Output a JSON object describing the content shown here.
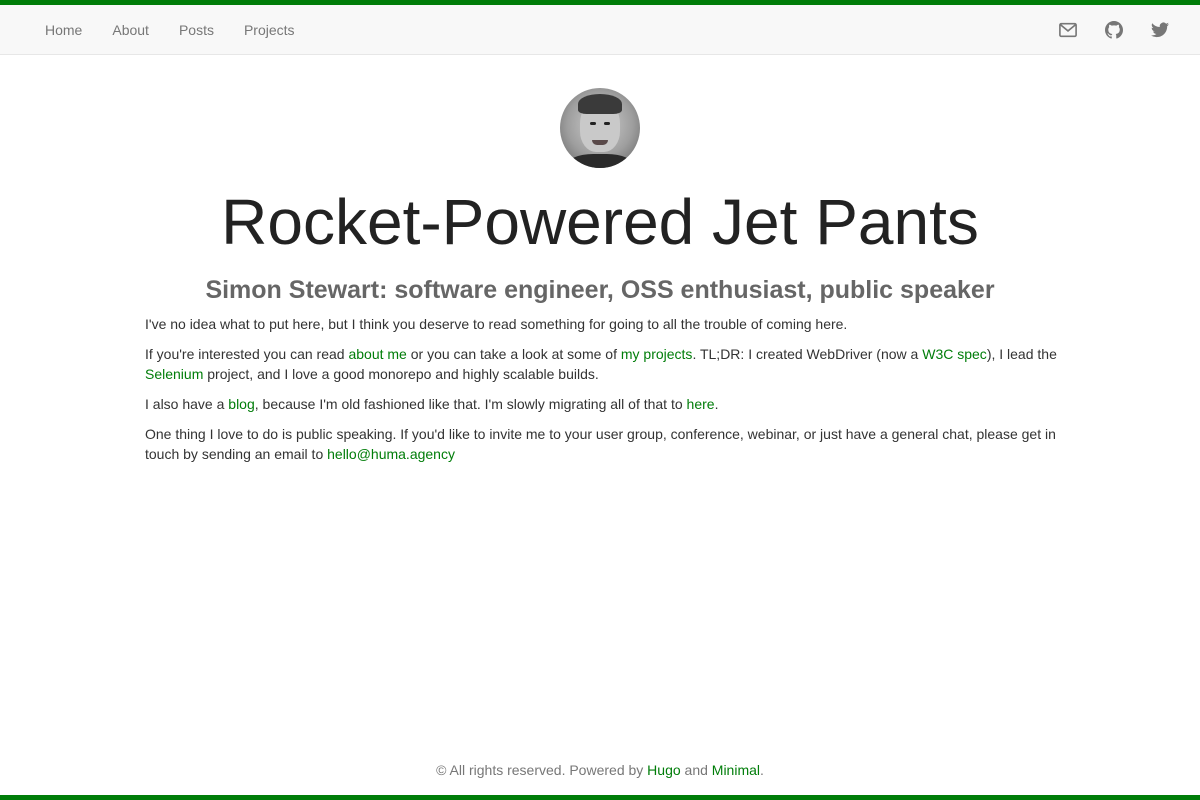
{
  "nav": {
    "links": [
      "Home",
      "About",
      "Posts",
      "Projects"
    ],
    "icons": [
      "envelope-icon",
      "github-icon",
      "twitter-icon"
    ]
  },
  "header": {
    "title": "Rocket-Powered Jet Pants",
    "subtitle": "Simon Stewart: software engineer, OSS enthusiast, public speaker"
  },
  "content": {
    "p1": "I've no idea what to put here, but I think you deserve to read something for going to all the trouble of coming here.",
    "p2": {
      "t1": "If you're interested you can read ",
      "link_about": "about me",
      "t2": " or you can take a look at some of ",
      "link_projects": "my projects",
      "t3": ". TL;DR: I created WebDriver (now a ",
      "link_w3c": "W3C spec",
      "t4": "), I lead the ",
      "link_selenium": "Selenium",
      "t5": " project, and I love a good monorepo and highly scalable builds."
    },
    "p3": {
      "t1": "I also have a ",
      "link_blog": "blog",
      "t2": ", because I'm old fashioned like that. I'm slowly migrating all of that to ",
      "link_here": "here",
      "t3": "."
    },
    "p4": {
      "t1": "One thing I love to do is public speaking. If you'd like to invite me to your user group, conference, webinar, or just have a general chat, please get in touch by sending an email to ",
      "link_email": "hello@huma.agency"
    }
  },
  "footer": {
    "t1": "© All rights reserved. Powered by ",
    "link_hugo": "Hugo",
    "t2": " and ",
    "link_minimal": "Minimal",
    "t3": "."
  },
  "colors": {
    "accent": "#007d09",
    "navbar_bg": "#f8f8f8",
    "nav_text": "#777777"
  }
}
